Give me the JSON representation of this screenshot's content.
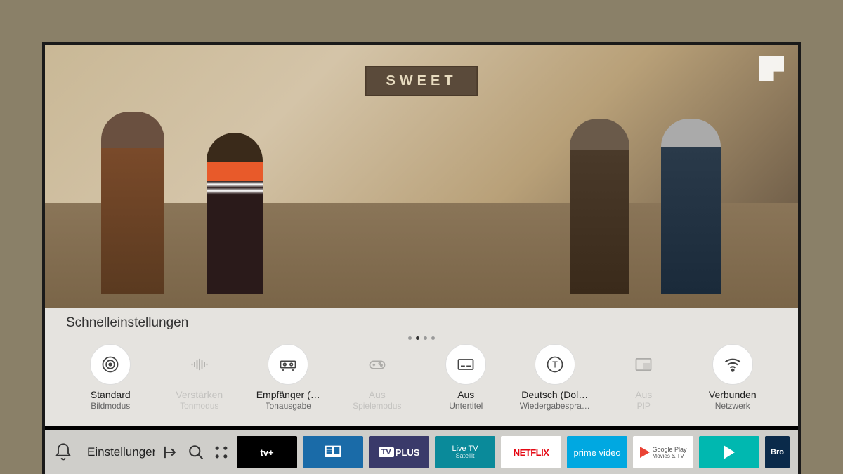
{
  "scene": {
    "sign_text": "SWEET",
    "channel": "ProSieben"
  },
  "quick": {
    "title": "Schnelleinstellungen",
    "page_dots": 4,
    "active_dot": 1,
    "items": [
      {
        "id": "picture-mode",
        "value": "Standard",
        "label": "Bildmodus",
        "dim": false,
        "icon": "circles"
      },
      {
        "id": "sound-mode",
        "value": "Verstärken",
        "label": "Tonmodus",
        "dim": true,
        "icon": "wave"
      },
      {
        "id": "sound-output",
        "value": "Empfänger (…",
        "label": "Tonausgabe",
        "dim": false,
        "icon": "receiver"
      },
      {
        "id": "game-mode",
        "value": "Aus",
        "label": "Spielemodus",
        "dim": true,
        "icon": "gamepad"
      },
      {
        "id": "subtitle",
        "value": "Aus",
        "label": "Untertitel",
        "dim": false,
        "icon": "subtitle"
      },
      {
        "id": "audio-language",
        "value": "Deutsch (Dol…",
        "label": "Wiedergabespra…",
        "dim": false,
        "icon": "language"
      },
      {
        "id": "pip",
        "value": "Aus",
        "label": "PIP",
        "dim": true,
        "icon": "pip"
      },
      {
        "id": "network",
        "value": "Verbunden",
        "label": "Netzwerk",
        "dim": false,
        "icon": "wifi"
      }
    ]
  },
  "bottom": {
    "settings_label": "Einstellungen",
    "apps": [
      {
        "id": "apple-tv",
        "label": "tv+",
        "class": "app-atv"
      },
      {
        "id": "guide",
        "label": "",
        "class": "app-guide"
      },
      {
        "id": "tv-plus",
        "label": "TV PLUS",
        "class": "app-tvplus"
      },
      {
        "id": "live-tv",
        "label": "Live TV",
        "sub": "Satellit",
        "class": "app-livetv"
      },
      {
        "id": "netflix",
        "label": "NETFLIX",
        "class": "app-netflix"
      },
      {
        "id": "prime-video",
        "label": "prime video",
        "class": "app-prime"
      },
      {
        "id": "google-play",
        "label": "Google Play",
        "sub": "Movies & TV",
        "class": "app-gplay"
      },
      {
        "id": "media",
        "label": "",
        "class": "app-teal"
      },
      {
        "id": "browser",
        "label": "Bro",
        "class": "app-partial"
      }
    ]
  }
}
